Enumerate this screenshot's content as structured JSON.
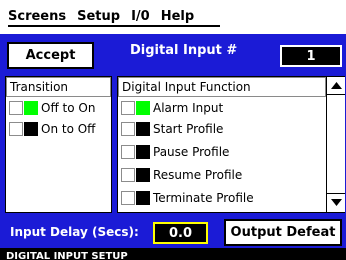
{
  "menu": {
    "items": [
      {
        "label": "Screens"
      },
      {
        "label": "Setup"
      },
      {
        "label": "I/0"
      },
      {
        "label": "Help"
      }
    ]
  },
  "toolbar": {
    "accept_label": "Accept",
    "title": "Digital Input #",
    "input_number": "1"
  },
  "transition_list": {
    "header": "Transition",
    "items": [
      {
        "label": "Off to On",
        "swatch_color": "#00ff00"
      },
      {
        "label": "On to Off",
        "swatch_color": "#000000"
      }
    ]
  },
  "function_list": {
    "header": "Digital Input Function",
    "items": [
      {
        "label": "Alarm Input",
        "swatch_color": "#00ff00"
      },
      {
        "label": "Start Profile",
        "swatch_color": "#000000"
      },
      {
        "label": "Pause Profile",
        "swatch_color": "#000000"
      },
      {
        "label": "Resume Profile",
        "swatch_color": "#000000"
      },
      {
        "label": "Terminate Profile",
        "swatch_color": "#000000"
      }
    ],
    "scroll_up_icon": "triangle-up",
    "scroll_down_icon": "triangle-down"
  },
  "footer": {
    "delay_label": "Input Delay (Secs):",
    "delay_value": "0.0",
    "output_defeat_label": "Output Defeat"
  },
  "status": {
    "text": "DIGITAL INPUT SETUP"
  },
  "colors": {
    "panel_blue": "#1b1bd6",
    "highlight_green": "#00ff00",
    "value_border_yellow": "#ffff00"
  }
}
